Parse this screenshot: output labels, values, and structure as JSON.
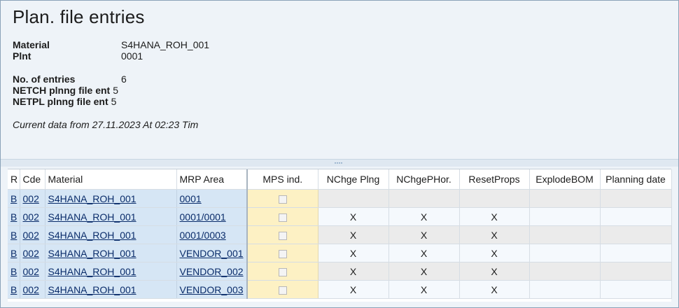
{
  "page": {
    "title": "Plan. file entries"
  },
  "header": {
    "material_label": "Material",
    "material_value": "S4HANA_ROH_001",
    "plant_label": "Plnt",
    "plant_value": "0001",
    "entries_label": "No. of entries",
    "entries_value": "6",
    "netch_label": "NETCH plnng file ent",
    "netch_value": "5",
    "netpl_label": "NETPL plnng file ent",
    "netpl_value": "5",
    "current_data": "Current data from 27.11.2023 At 02:23 Tim"
  },
  "splitter": {
    "grip": "····"
  },
  "table": {
    "columns": [
      "R",
      "Cde",
      "Material",
      "MRP Area",
      "MPS ind.",
      "NChge Plng",
      "NChgePHor.",
      "ResetProps",
      "ExplodeBOM",
      "Planning date"
    ],
    "rows": [
      {
        "r": "B",
        "cde": "002",
        "material": "S4HANA_ROH_001",
        "mrp_area": "0001",
        "nchge_plng": "",
        "nchge_phor": "",
        "reset_props": "",
        "explode_bom": "",
        "planning_date": ""
      },
      {
        "r": "B",
        "cde": "002",
        "material": "S4HANA_ROH_001",
        "mrp_area": "0001/0001",
        "nchge_plng": "X",
        "nchge_phor": "X",
        "reset_props": "X",
        "explode_bom": "",
        "planning_date": ""
      },
      {
        "r": "B",
        "cde": "002",
        "material": "S4HANA_ROH_001",
        "mrp_area": "0001/0003",
        "nchge_plng": "X",
        "nchge_phor": "X",
        "reset_props": "X",
        "explode_bom": "",
        "planning_date": ""
      },
      {
        "r": "B",
        "cde": "002",
        "material": "S4HANA_ROH_001",
        "mrp_area": "VENDOR_001",
        "nchge_plng": "X",
        "nchge_phor": "X",
        "reset_props": "X",
        "explode_bom": "",
        "planning_date": ""
      },
      {
        "r": "B",
        "cde": "002",
        "material": "S4HANA_ROH_001",
        "mrp_area": "VENDOR_002",
        "nchge_plng": "X",
        "nchge_phor": "X",
        "reset_props": "X",
        "explode_bom": "",
        "planning_date": ""
      },
      {
        "r": "B",
        "cde": "002",
        "material": "S4HANA_ROH_001",
        "mrp_area": "VENDOR_003",
        "nchge_plng": "X",
        "nchge_phor": "X",
        "reset_props": "X",
        "explode_bom": "",
        "planning_date": ""
      }
    ]
  }
}
